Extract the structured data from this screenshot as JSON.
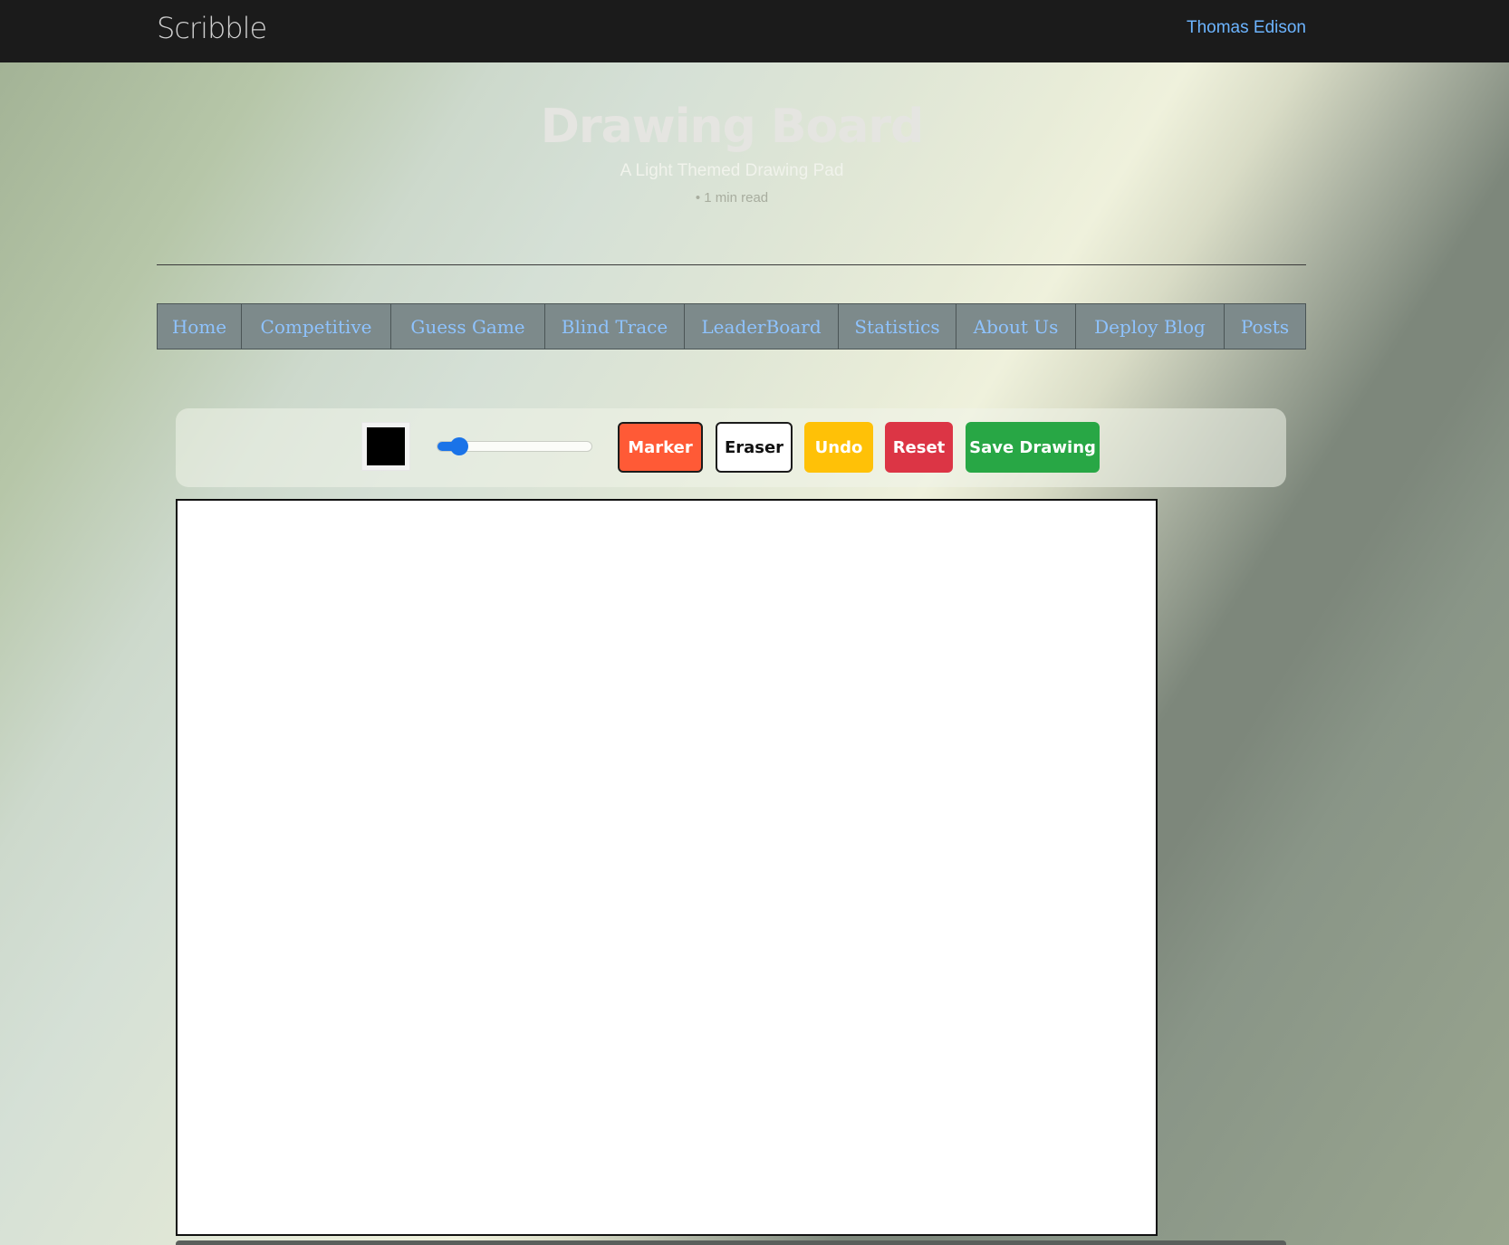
{
  "header": {
    "brand": "Scribble",
    "user_name": "Thomas Edison"
  },
  "post": {
    "title": "Drawing Board",
    "subtitle": "A Light Themed Drawing Pad",
    "read_time": "• 1 min read"
  },
  "nav": {
    "items": [
      {
        "label": "Home"
      },
      {
        "label": "Competitive"
      },
      {
        "label": "Guess Game"
      },
      {
        "label": "Blind Trace"
      },
      {
        "label": "LeaderBoard"
      },
      {
        "label": "Statistics"
      },
      {
        "label": "About Us"
      },
      {
        "label": "Deploy Blog"
      },
      {
        "label": "Posts"
      }
    ]
  },
  "toolbar": {
    "color_value": "#000000",
    "brush_size_fraction": 0.14,
    "marker_label": "Marker",
    "eraser_label": "Eraser",
    "undo_label": "Undo",
    "reset_label": "Reset",
    "save_label": "Save Drawing"
  },
  "colors": {
    "link": "#8ec3ff",
    "marker": "#ff5a36",
    "undo": "#ffc107",
    "reset": "#dc3545",
    "save": "#28a745",
    "slider_accent": "#1a73e8"
  }
}
